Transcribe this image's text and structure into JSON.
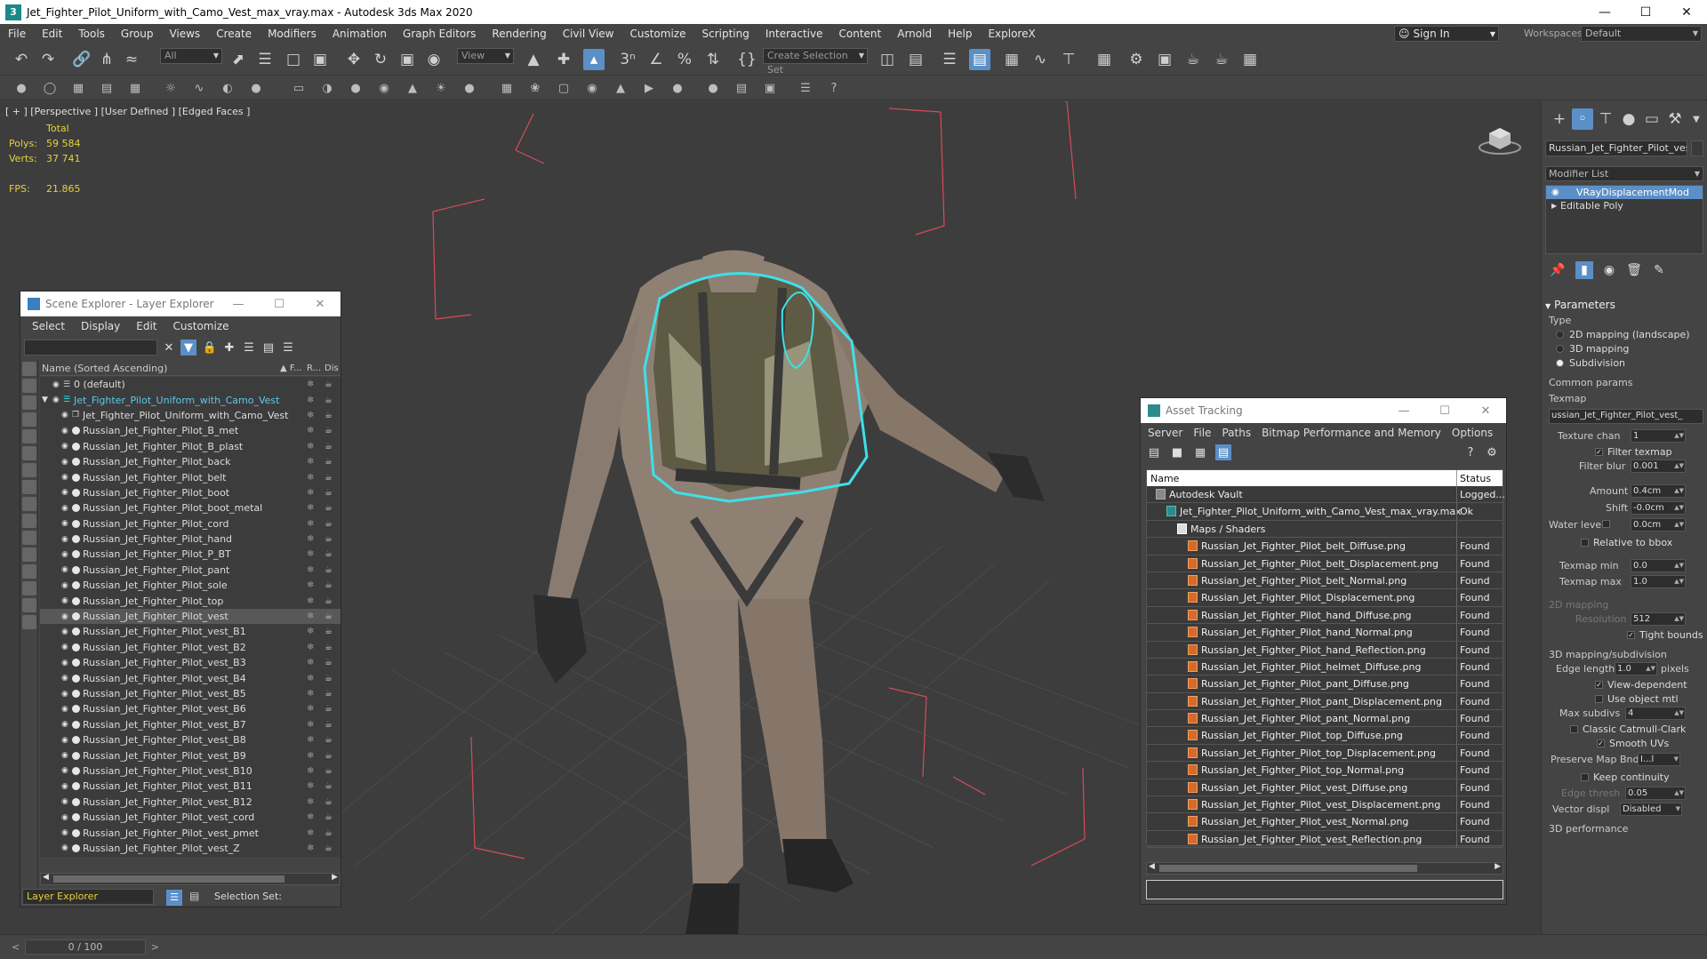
{
  "window": {
    "title": "Jet_Fighter_Pilot_Uniform_with_Camo_Vest_max_vray.max - Autodesk 3ds Max 2020",
    "app_icon": "3"
  },
  "menu": [
    "File",
    "Edit",
    "Tools",
    "Group",
    "Views",
    "Create",
    "Modifiers",
    "Animation",
    "Graph Editors",
    "Rendering",
    "Civil View",
    "Customize",
    "Scripting",
    "Interactive",
    "Content",
    "Arnold",
    "Help",
    "ExploreX"
  ],
  "account": {
    "signin_label": "Sign In",
    "workspaces_label": "Workspaces:",
    "workspace_value": "Default"
  },
  "toolbar": {
    "selection_filter": "All",
    "ref_coord": "View",
    "selection_set_placeholder": "Create Selection Set"
  },
  "viewport": {
    "label": "[ + ] [Perspective ] [User Defined ] [Edged Faces ]",
    "stats": {
      "total_label": "Total",
      "polys_label": "Polys:",
      "polys_value": "59 584",
      "verts_label": "Verts:",
      "verts_value": "37 741",
      "fps_label": "FPS:",
      "fps_value": "21.865"
    }
  },
  "scene_explorer": {
    "title": "Scene Explorer - Layer Explorer",
    "menu": [
      "Select",
      "Display",
      "Edit",
      "Customize"
    ],
    "columns": {
      "name": "Name (Sorted Ascending)",
      "frozen": "▲ F...",
      "renderable": "R...",
      "display": "Dis"
    },
    "rows": [
      {
        "name": "0 (default)",
        "level": 0,
        "kind": "layer"
      },
      {
        "name": "Jet_Fighter_Pilot_Uniform_with_Camo_Vest",
        "level": 0,
        "kind": "layer-active"
      },
      {
        "name": "Jet_Fighter_Pilot_Uniform_with_Camo_Vest",
        "level": 1,
        "kind": "group"
      },
      {
        "name": "Russian_Jet_Fighter_Pilot_B_met",
        "level": 1,
        "kind": "object"
      },
      {
        "name": "Russian_Jet_Fighter_Pilot_B_plast",
        "level": 1,
        "kind": "object"
      },
      {
        "name": "Russian_Jet_Fighter_Pilot_back",
        "level": 1,
        "kind": "object"
      },
      {
        "name": "Russian_Jet_Fighter_Pilot_belt",
        "level": 1,
        "kind": "object"
      },
      {
        "name": "Russian_Jet_Fighter_Pilot_boot",
        "level": 1,
        "kind": "object"
      },
      {
        "name": "Russian_Jet_Fighter_Pilot_boot_metal",
        "level": 1,
        "kind": "object"
      },
      {
        "name": "Russian_Jet_Fighter_Pilot_cord",
        "level": 1,
        "kind": "object"
      },
      {
        "name": "Russian_Jet_Fighter_Pilot_hand",
        "level": 1,
        "kind": "object"
      },
      {
        "name": "Russian_Jet_Fighter_Pilot_P_BT",
        "level": 1,
        "kind": "object"
      },
      {
        "name": "Russian_Jet_Fighter_Pilot_pant",
        "level": 1,
        "kind": "object"
      },
      {
        "name": "Russian_Jet_Fighter_Pilot_sole",
        "level": 1,
        "kind": "object"
      },
      {
        "name": "Russian_Jet_Fighter_Pilot_top",
        "level": 1,
        "kind": "object"
      },
      {
        "name": "Russian_Jet_Fighter_Pilot_vest",
        "level": 1,
        "kind": "object-selected"
      },
      {
        "name": "Russian_Jet_Fighter_Pilot_vest_B1",
        "level": 1,
        "kind": "object"
      },
      {
        "name": "Russian_Jet_Fighter_Pilot_vest_B2",
        "level": 1,
        "kind": "object"
      },
      {
        "name": "Russian_Jet_Fighter_Pilot_vest_B3",
        "level": 1,
        "kind": "object"
      },
      {
        "name": "Russian_Jet_Fighter_Pilot_vest_B4",
        "level": 1,
        "kind": "object"
      },
      {
        "name": "Russian_Jet_Fighter_Pilot_vest_B5",
        "level": 1,
        "kind": "object"
      },
      {
        "name": "Russian_Jet_Fighter_Pilot_vest_B6",
        "level": 1,
        "kind": "object"
      },
      {
        "name": "Russian_Jet_Fighter_Pilot_vest_B7",
        "level": 1,
        "kind": "object"
      },
      {
        "name": "Russian_Jet_Fighter_Pilot_vest_B8",
        "level": 1,
        "kind": "object"
      },
      {
        "name": "Russian_Jet_Fighter_Pilot_vest_B9",
        "level": 1,
        "kind": "object"
      },
      {
        "name": "Russian_Jet_Fighter_Pilot_vest_B10",
        "level": 1,
        "kind": "object"
      },
      {
        "name": "Russian_Jet_Fighter_Pilot_vest_B11",
        "level": 1,
        "kind": "object"
      },
      {
        "name": "Russian_Jet_Fighter_Pilot_vest_B12",
        "level": 1,
        "kind": "object"
      },
      {
        "name": "Russian_Jet_Fighter_Pilot_vest_cord",
        "level": 1,
        "kind": "object"
      },
      {
        "name": "Russian_Jet_Fighter_Pilot_vest_pmet",
        "level": 1,
        "kind": "object"
      },
      {
        "name": "Russian_Jet_Fighter_Pilot_vest_Z",
        "level": 1,
        "kind": "object"
      }
    ],
    "footer": {
      "explorer": "Layer Explorer",
      "selection_set_label": "Selection Set:"
    }
  },
  "asset_tracking": {
    "title": "Asset Tracking",
    "menu": [
      "Server",
      "File",
      "Paths",
      "Bitmap Performance and Memory",
      "Options"
    ],
    "columns": {
      "name": "Name",
      "status": "Status"
    },
    "rows": [
      {
        "name": "Autodesk Vault",
        "status": "Logged...",
        "level": 0,
        "icon": "vault"
      },
      {
        "name": "Jet_Fighter_Pilot_Uniform_with_Camo_Vest_max_vray.max",
        "status": "Ok",
        "level": 1,
        "icon": "max"
      },
      {
        "name": "Maps / Shaders",
        "status": "",
        "level": 2,
        "icon": "folder"
      },
      {
        "name": "Russian_Jet_Fighter_Pilot_belt_Diffuse.png",
        "status": "Found",
        "level": 3,
        "icon": "png"
      },
      {
        "name": "Russian_Jet_Fighter_Pilot_belt_Displacement.png",
        "status": "Found",
        "level": 3,
        "icon": "png"
      },
      {
        "name": "Russian_Jet_Fighter_Pilot_belt_Normal.png",
        "status": "Found",
        "level": 3,
        "icon": "png"
      },
      {
        "name": "Russian_Jet_Fighter_Pilot_Displacement.png",
        "status": "Found",
        "level": 3,
        "icon": "png"
      },
      {
        "name": "Russian_Jet_Fighter_Pilot_hand_Diffuse.png",
        "status": "Found",
        "level": 3,
        "icon": "png"
      },
      {
        "name": "Russian_Jet_Fighter_Pilot_hand_Normal.png",
        "status": "Found",
        "level": 3,
        "icon": "png"
      },
      {
        "name": "Russian_Jet_Fighter_Pilot_hand_Reflection.png",
        "status": "Found",
        "level": 3,
        "icon": "png"
      },
      {
        "name": "Russian_Jet_Fighter_Pilot_helmet_Diffuse.png",
        "status": "Found",
        "level": 3,
        "icon": "png"
      },
      {
        "name": "Russian_Jet_Fighter_Pilot_pant_Diffuse.png",
        "status": "Found",
        "level": 3,
        "icon": "png"
      },
      {
        "name": "Russian_Jet_Fighter_Pilot_pant_Displacement.png",
        "status": "Found",
        "level": 3,
        "icon": "png"
      },
      {
        "name": "Russian_Jet_Fighter_Pilot_pant_Normal.png",
        "status": "Found",
        "level": 3,
        "icon": "png"
      },
      {
        "name": "Russian_Jet_Fighter_Pilot_top_Diffuse.png",
        "status": "Found",
        "level": 3,
        "icon": "png"
      },
      {
        "name": "Russian_Jet_Fighter_Pilot_top_Displacement.png",
        "status": "Found",
        "level": 3,
        "icon": "png"
      },
      {
        "name": "Russian_Jet_Fighter_Pilot_top_Normal.png",
        "status": "Found",
        "level": 3,
        "icon": "png"
      },
      {
        "name": "Russian_Jet_Fighter_Pilot_vest_Diffuse.png",
        "status": "Found",
        "level": 3,
        "icon": "png"
      },
      {
        "name": "Russian_Jet_Fighter_Pilot_vest_Displacement.png",
        "status": "Found",
        "level": 3,
        "icon": "png"
      },
      {
        "name": "Russian_Jet_Fighter_Pilot_vest_Normal.png",
        "status": "Found",
        "level": 3,
        "icon": "png"
      },
      {
        "name": "Russian_Jet_Fighter_Pilot_vest_Reflection.png",
        "status": "Found",
        "level": 3,
        "icon": "png"
      }
    ]
  },
  "command_panel": {
    "object_name": "Russian_Jet_Fighter_Pilot_vest",
    "modifier_list_label": "Modifier List",
    "stack": [
      {
        "name": "VRayDisplacementMod",
        "selected": true
      },
      {
        "name": "Editable Poly",
        "selected": false
      }
    ],
    "parameters": {
      "rollout": "Parameters",
      "type_label": "Type",
      "type_options": [
        "2D mapping (landscape)",
        "3D mapping",
        "Subdivision"
      ],
      "type_selected": "Subdivision",
      "common_label": "Common params",
      "texmap_label": "Texmap",
      "texmap_value": "ussian_Jet_Fighter_Pilot_vest_",
      "texture_chan_label": "Texture chan",
      "texture_chan_value": "1",
      "filter_texmap_label": "Filter texmap",
      "filter_blur_label": "Filter blur",
      "filter_blur_value": "0.001",
      "amount_label": "Amount",
      "amount_value": "0.4cm",
      "shift_label": "Shift",
      "shift_value": "-0.0cm",
      "water_level_label": "Water level",
      "water_level_value": "0.0cm",
      "relative_bbox_label": "Relative to bbox",
      "texmap_min_label": "Texmap min",
      "texmap_min_value": "0.0",
      "texmap_max_label": "Texmap max",
      "texmap_max_value": "1.0",
      "mapping2d_label": "2D mapping",
      "resolution_label": "Resolution",
      "resolution_value": "512",
      "tight_bounds_label": "Tight bounds",
      "mapping3d_label": "3D mapping/subdivision",
      "edge_length_label": "Edge length",
      "edge_length_value": "1.0",
      "pixels_label": "pixels",
      "view_dependent_label": "View-dependent",
      "use_object_mtl_label": "Use object mtl",
      "max_subdivs_label": "Max subdivs",
      "max_subdivs_value": "4",
      "classic_cc_label": "Classic Catmull-Clark",
      "smooth_uvs_label": "Smooth UVs",
      "preserve_map_label": "Preserve Map Bnd",
      "preserve_map_value": "I...l",
      "keep_continuity_label": "Keep continuity",
      "edge_thresh_label": "Edge thresh",
      "edge_thresh_value": "0.05",
      "vector_displ_label": "Vector displ",
      "vector_displ_value": "Disabled",
      "performance_label": "3D performance"
    }
  },
  "timeline": {
    "frame": "0 / 100"
  },
  "colors": {
    "accent": "#5b8fc7",
    "stat_yellow": "#e8d13a",
    "selection_cyan": "#3ee0e8",
    "bbox_red": "#d84a5a"
  }
}
